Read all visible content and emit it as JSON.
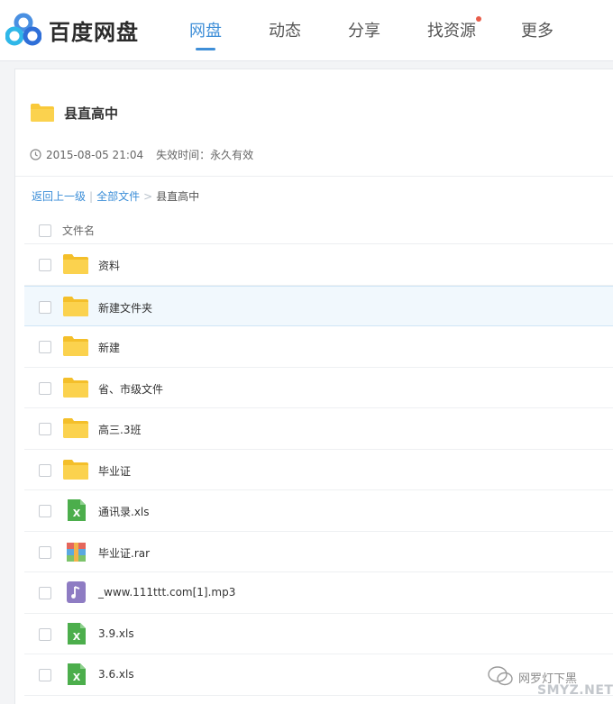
{
  "header": {
    "logo_text": "百度网盘",
    "nav": [
      {
        "label": "网盘",
        "active": true
      },
      {
        "label": "动态",
        "active": false
      },
      {
        "label": "分享",
        "active": false
      },
      {
        "label": "找资源",
        "active": false,
        "has_notification_dot": true
      },
      {
        "label": "更多",
        "active": false
      }
    ]
  },
  "share": {
    "title": "县直高中",
    "date": "2015-08-05 21:04",
    "expire": "失效时间：永久有效"
  },
  "breadcrumb": {
    "back": "返回上一级",
    "separator": "|",
    "all_files": "全部文件",
    "arrow": ">",
    "current": "县直高中"
  },
  "list": {
    "header_label": "文件名",
    "rows": [
      {
        "name": "资料",
        "type": "folder",
        "icon": "folder-icon"
      },
      {
        "name": "新建文件夹",
        "type": "folder",
        "icon": "folder-icon",
        "highlighted": true
      },
      {
        "name": "新建",
        "type": "folder",
        "icon": "folder-icon"
      },
      {
        "name": "省、市级文件",
        "type": "folder",
        "icon": "folder-icon"
      },
      {
        "name": "高三.3班",
        "type": "folder",
        "icon": "folder-icon"
      },
      {
        "name": "毕业证",
        "type": "folder",
        "icon": "folder-icon"
      },
      {
        "name": "通讯录.xls",
        "type": "xls",
        "icon": "excel-icon"
      },
      {
        "name": "毕业证.rar",
        "type": "rar",
        "icon": "archive-icon"
      },
      {
        "name": "_www.111ttt.com[1].mp3",
        "type": "mp3",
        "icon": "music-icon"
      },
      {
        "name": "3.9.xls",
        "type": "xls",
        "icon": "excel-icon"
      },
      {
        "name": "3.6.xls",
        "type": "xls",
        "icon": "excel-icon"
      }
    ]
  },
  "watermark": {
    "text": "网罗灯下黑",
    "site": "SMYZ.NET"
  },
  "colors": {
    "accent": "#3f8fd8",
    "folder": "#f9c93a",
    "excel": "#4cae4c",
    "music": "#8e7cc3",
    "notification": "#e85d4a"
  }
}
